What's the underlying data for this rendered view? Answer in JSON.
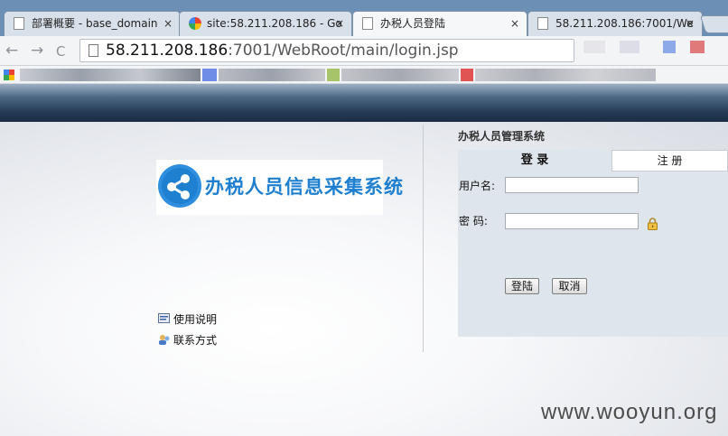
{
  "browser": {
    "tabs": [
      {
        "title": "部署概要 - base_domain",
        "icon": "page-icon",
        "active": false
      },
      {
        "title": "site:58.211.208.186 - Go",
        "icon": "google-icon",
        "active": false
      },
      {
        "title": "办税人员登陆",
        "icon": "page-icon",
        "active": true
      },
      {
        "title": "58.211.208.186:7001/We",
        "icon": "page-icon",
        "active": false
      }
    ],
    "close_glyph": "×",
    "nav": {
      "back": "←",
      "forward": "→",
      "reload": "C"
    },
    "address": {
      "host": "58.211.208.186",
      "path": ":7001/WebRoot/main/login.jsp"
    }
  },
  "page": {
    "logo_text": "办税人员信息采集系统",
    "links": [
      {
        "label": "使用说明",
        "icon": "help-doc-icon"
      },
      {
        "label": "联系方式",
        "icon": "contact-icon"
      }
    ],
    "system_title": "办税人员管理系统",
    "tabs": {
      "login": "登 录",
      "register": "注 册"
    },
    "form": {
      "username_label": "用户名:",
      "password_label": "密 码:",
      "username_value": "",
      "password_value": ""
    },
    "buttons": {
      "login": "登陆",
      "cancel": "取消"
    }
  },
  "watermark": "www.wooyun.org",
  "colors": {
    "accent": "#1e7fd0",
    "banner": "#243a55",
    "panel": "#dfe5ec"
  }
}
